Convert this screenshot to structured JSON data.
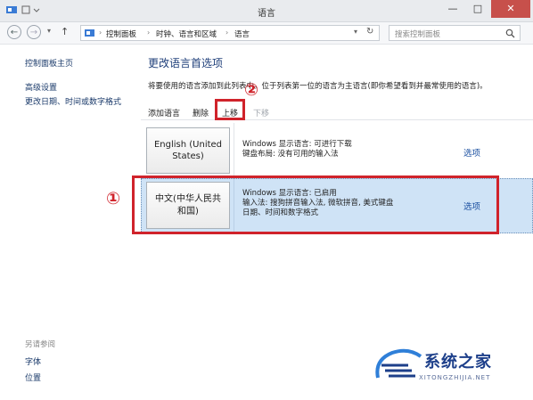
{
  "window": {
    "title": "语言",
    "minimize_glyph": "—",
    "maximize_glyph": "□",
    "close_glyph": "✕"
  },
  "address": {
    "crumbs": [
      "控制面板",
      "时钟、语言和区域",
      "语言"
    ],
    "separator": "›",
    "back_glyph": "←",
    "forward_glyph": "→",
    "up_glyph": "↑",
    "dropdown_glyph": "▾",
    "refresh_glyph": "↻",
    "search_placeholder": "搜索控制面板"
  },
  "sidebar": {
    "home_label": "控制面板主页",
    "links": [
      "高级设置",
      "更改日期、时间或数字格式"
    ],
    "see_also_title": "另请参阅",
    "see_also": [
      "字体",
      "位置"
    ]
  },
  "main": {
    "heading": "更改语言首选项",
    "description": "将要使用的语言添加到此列表中。位于列表第一位的语言为主语言(即你希望看到并最常使用的语言)。",
    "toolbar": {
      "add": "添加语言",
      "remove": "删除",
      "move_up": "上移",
      "move_down": "下移"
    },
    "languages": [
      {
        "name_line1": "English (United",
        "name_line2": "States)",
        "info_line1": "Windows 显示语言: 可进行下载",
        "info_line2": "键盘布局: 没有可用的输入法",
        "info_line3": "",
        "options": "选项"
      },
      {
        "name_line1": "中文(中华人民共",
        "name_line2": "和国)",
        "info_line1": "Windows 显示语言: 已启用",
        "info_line2": "输入法: 搜狗拼音输入法, 微软拼音, 美式键盘",
        "info_line3": "日期、时间和数字格式",
        "options": "选项"
      }
    ]
  },
  "annotations": {
    "marker1": "①",
    "marker2": "②",
    "red": "#d0232b"
  },
  "watermark": {
    "text": "系统之家",
    "sub": "XITONGZHIJIA.NET"
  }
}
